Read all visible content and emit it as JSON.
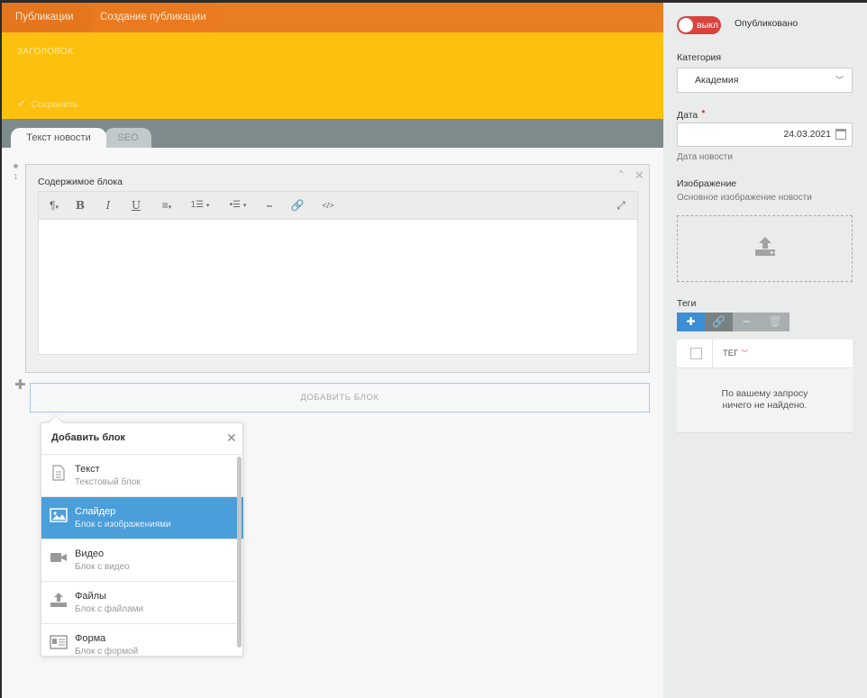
{
  "breadcrumb": {
    "items": [
      "Публикации",
      "Создание публикации"
    ]
  },
  "header": {
    "title_placeholder": "ЗАГОЛОВОК",
    "save_label": "Сохранить"
  },
  "tabs": [
    {
      "label": "Текст новости",
      "active": true
    },
    {
      "label": "SEO",
      "active": false
    }
  ],
  "block": {
    "row_number": "1",
    "title": "Содержимое блока",
    "toolbar": [
      "paragraph-icon",
      "bold-icon",
      "italic-icon",
      "underline-icon",
      "align-icon",
      "ordered-list-icon",
      "unordered-list-icon",
      "horizontal-rule-icon",
      "link-icon",
      "code-icon",
      "fullscreen-icon"
    ]
  },
  "add_block": {
    "button_label": "ДОБАВИТЬ БЛОК"
  },
  "popup": {
    "title": "Добавить блок",
    "items": [
      {
        "name": "Текст",
        "desc": "Текстовый блок",
        "icon": "document-icon",
        "active": false
      },
      {
        "name": "Слайдер",
        "desc": "Блок с изображениями",
        "icon": "image-icon",
        "active": true
      },
      {
        "name": "Видео",
        "desc": "Блок с видео",
        "icon": "video-icon",
        "active": false
      },
      {
        "name": "Файлы",
        "desc": "Блок с файлами",
        "icon": "upload-icon",
        "active": false
      },
      {
        "name": "Форма",
        "desc": "Блок с формой",
        "icon": "form-icon",
        "active": false
      }
    ]
  },
  "sidebar": {
    "toggle_label": "выкл",
    "published_label": "Опубликовано",
    "category_label": "Категория",
    "category_value": "Академия",
    "date_label": "Дата",
    "date_value": "24.03.2021",
    "date_hint": "Дата новости",
    "image_label": "Изображение",
    "image_hint": "Основное изображение новости",
    "tags_label": "Теги",
    "tags_column": "ТЕГ",
    "tags_empty_line1": "По вашему запросу",
    "tags_empty_line2": "ничего не найдено."
  },
  "colors": {
    "breadcrumb": "#e87e22",
    "header": "#fcc10e",
    "tabs_bar": "#7d8b8c",
    "toggle_off": "#d9433c",
    "active_item": "#4a9fdb",
    "tag_add": "#3d8fd5"
  }
}
